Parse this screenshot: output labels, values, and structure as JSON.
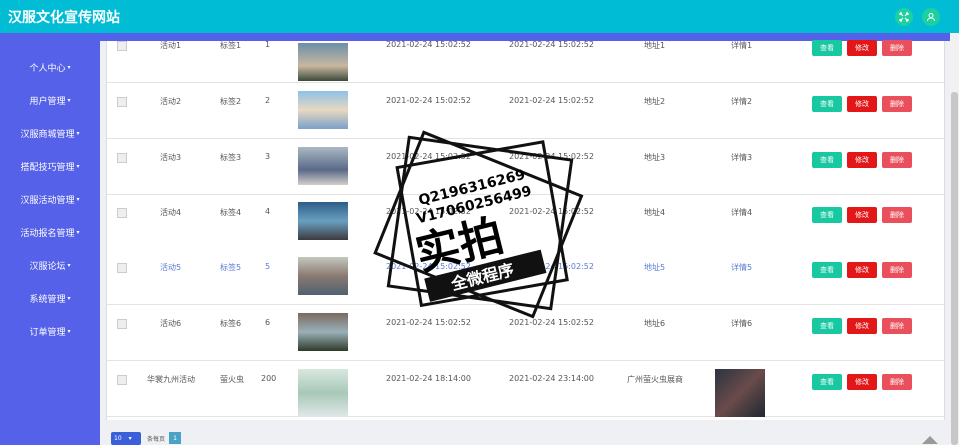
{
  "site_title": "汉服文化宣传网站",
  "top_icons": [
    "fullscreen-icon",
    "user-icon"
  ],
  "menu": [
    {
      "label": "个人中心"
    },
    {
      "label": "用户管理"
    },
    {
      "label": "汉服商城管理"
    },
    {
      "label": "搭配技巧管理"
    },
    {
      "label": "汉服活动管理"
    },
    {
      "label": "活动报名管理"
    },
    {
      "label": "汉服论坛"
    },
    {
      "label": "系统管理"
    },
    {
      "label": "订单管理"
    }
  ],
  "rows": [
    {
      "name": "活动1",
      "tag": "标签1",
      "num": "1",
      "start": "2021-02-24 15:02:52",
      "end": "2021-02-24 15:02:52",
      "addr": "地址1",
      "detail": "详情1"
    },
    {
      "name": "活动2",
      "tag": "标签2",
      "num": "2",
      "start": "2021-02-24 15:02:52",
      "end": "2021-02-24 15:02:52",
      "addr": "地址2",
      "detail": "详情2"
    },
    {
      "name": "活动3",
      "tag": "标签3",
      "num": "3",
      "start": "2021-02-24 15:02:52",
      "end": "2021-02-24 15:02:52",
      "addr": "地址3",
      "detail": "详情3"
    },
    {
      "name": "活动4",
      "tag": "标签4",
      "num": "4",
      "start": "2021-02-24 15:02:52",
      "end": "2021-02-24 15:02:52",
      "addr": "地址4",
      "detail": "详情4"
    },
    {
      "name": "活动5",
      "tag": "标签5",
      "num": "5",
      "start": "2021-02-24 15:02:52",
      "end": "2021-02-24 15:02:52",
      "addr": "地址5",
      "detail": "详情5"
    },
    {
      "name": "活动6",
      "tag": "标签6",
      "num": "6",
      "start": "2021-02-24 15:02:52",
      "end": "2021-02-24 15:02:52",
      "addr": "地址6",
      "detail": "详情6"
    },
    {
      "name": "华裳九州活动",
      "tag": "萤火虫",
      "num": "200",
      "start": "2021-02-24 18:14:00",
      "end": "2021-02-24 23:14:00",
      "addr": "广州萤火虫展商",
      "detail": ""
    }
  ],
  "buttons": {
    "view": "查看",
    "edit": "修改",
    "delete": "删除"
  },
  "pager": {
    "page_size": "10",
    "per_page_label": "条每页",
    "current_page": "1"
  },
  "watermark": {
    "contact_q": "Q2196316269",
    "contact_v": "V17060256499",
    "main": "实拍",
    "banner": "全微程序"
  },
  "colors": {
    "topbar": "#00bcd4",
    "sidebar": "#5561e8",
    "view": "#18c8a0",
    "edit": "#e21818",
    "delete": "#e9505c"
  }
}
